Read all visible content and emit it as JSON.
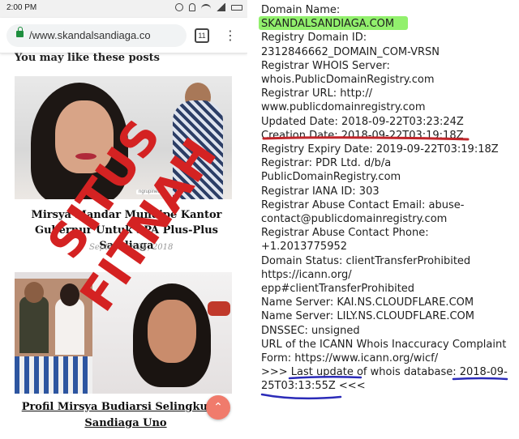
{
  "statusbar": {
    "time": "2:00 PM"
  },
  "browser": {
    "url": "/www.skandalsandiaga.co",
    "tab_count": "11",
    "menu_glyph": "⋮"
  },
  "page": {
    "section_title": "You may like these posts",
    "post1": {
      "title": "Mirsya Mandar Mundipe Kantor Gubernur Untuk SPA Plus-Plus Sandiaga",
      "date": "September 24, 2018",
      "badge": "ngrupinet"
    },
    "post2": {
      "title": "Profil Mirsya Budiarsi Selingkuhan Sandiaga Uno"
    },
    "fab_glyph": "⌃"
  },
  "stamp": {
    "line1": "SITUS",
    "line2": "FITNAH",
    "color": "#d42222"
  },
  "whois": {
    "lines": [
      "Domain Name:",
      "SKANDALSANDIAGA.COM",
      "Registry Domain ID:",
      "2312846662_DOMAIN_COM-VRSN",
      "Registrar WHOIS Server:",
      "whois.PublicDomainRegistry.com",
      "Registrar URL: http://",
      "www.publicdomainregistry.com",
      "Updated Date: 2018-09-22T03:23:24Z",
      "Creation Date: 2018-09-22T03:19:18Z",
      "Registry Expiry Date: 2019-09-22T03:19:18Z",
      "Registrar: PDR Ltd. d/b/a",
      "PublicDomainRegistry.com",
      "Registrar IANA ID: 303",
      "Registrar Abuse Contact Email: abuse-",
      "contact@publicdomainregistry.com",
      "Registrar Abuse Contact Phone:",
      "+1.2013775952",
      "Domain Status: clientTransferProhibited",
      "https://icann.org/",
      "epp#clientTransferProhibited",
      "Name Server: KAI.NS.CLOUDFLARE.COM",
      "Name Server: LILY.NS.CLOUDFLARE.COM",
      "DNSSEC: unsigned",
      "URL of the ICANN Whois Inaccuracy Complaint",
      "Form: https://www.icann.org/wicf/",
      ">>> Last update of whois database: 2018-09-",
      "25T03:13:55Z <<<"
    ],
    "highlight_color": "#6eeb3c",
    "underline_red": "#c0262b",
    "underline_blue": "#2b2bb8"
  }
}
